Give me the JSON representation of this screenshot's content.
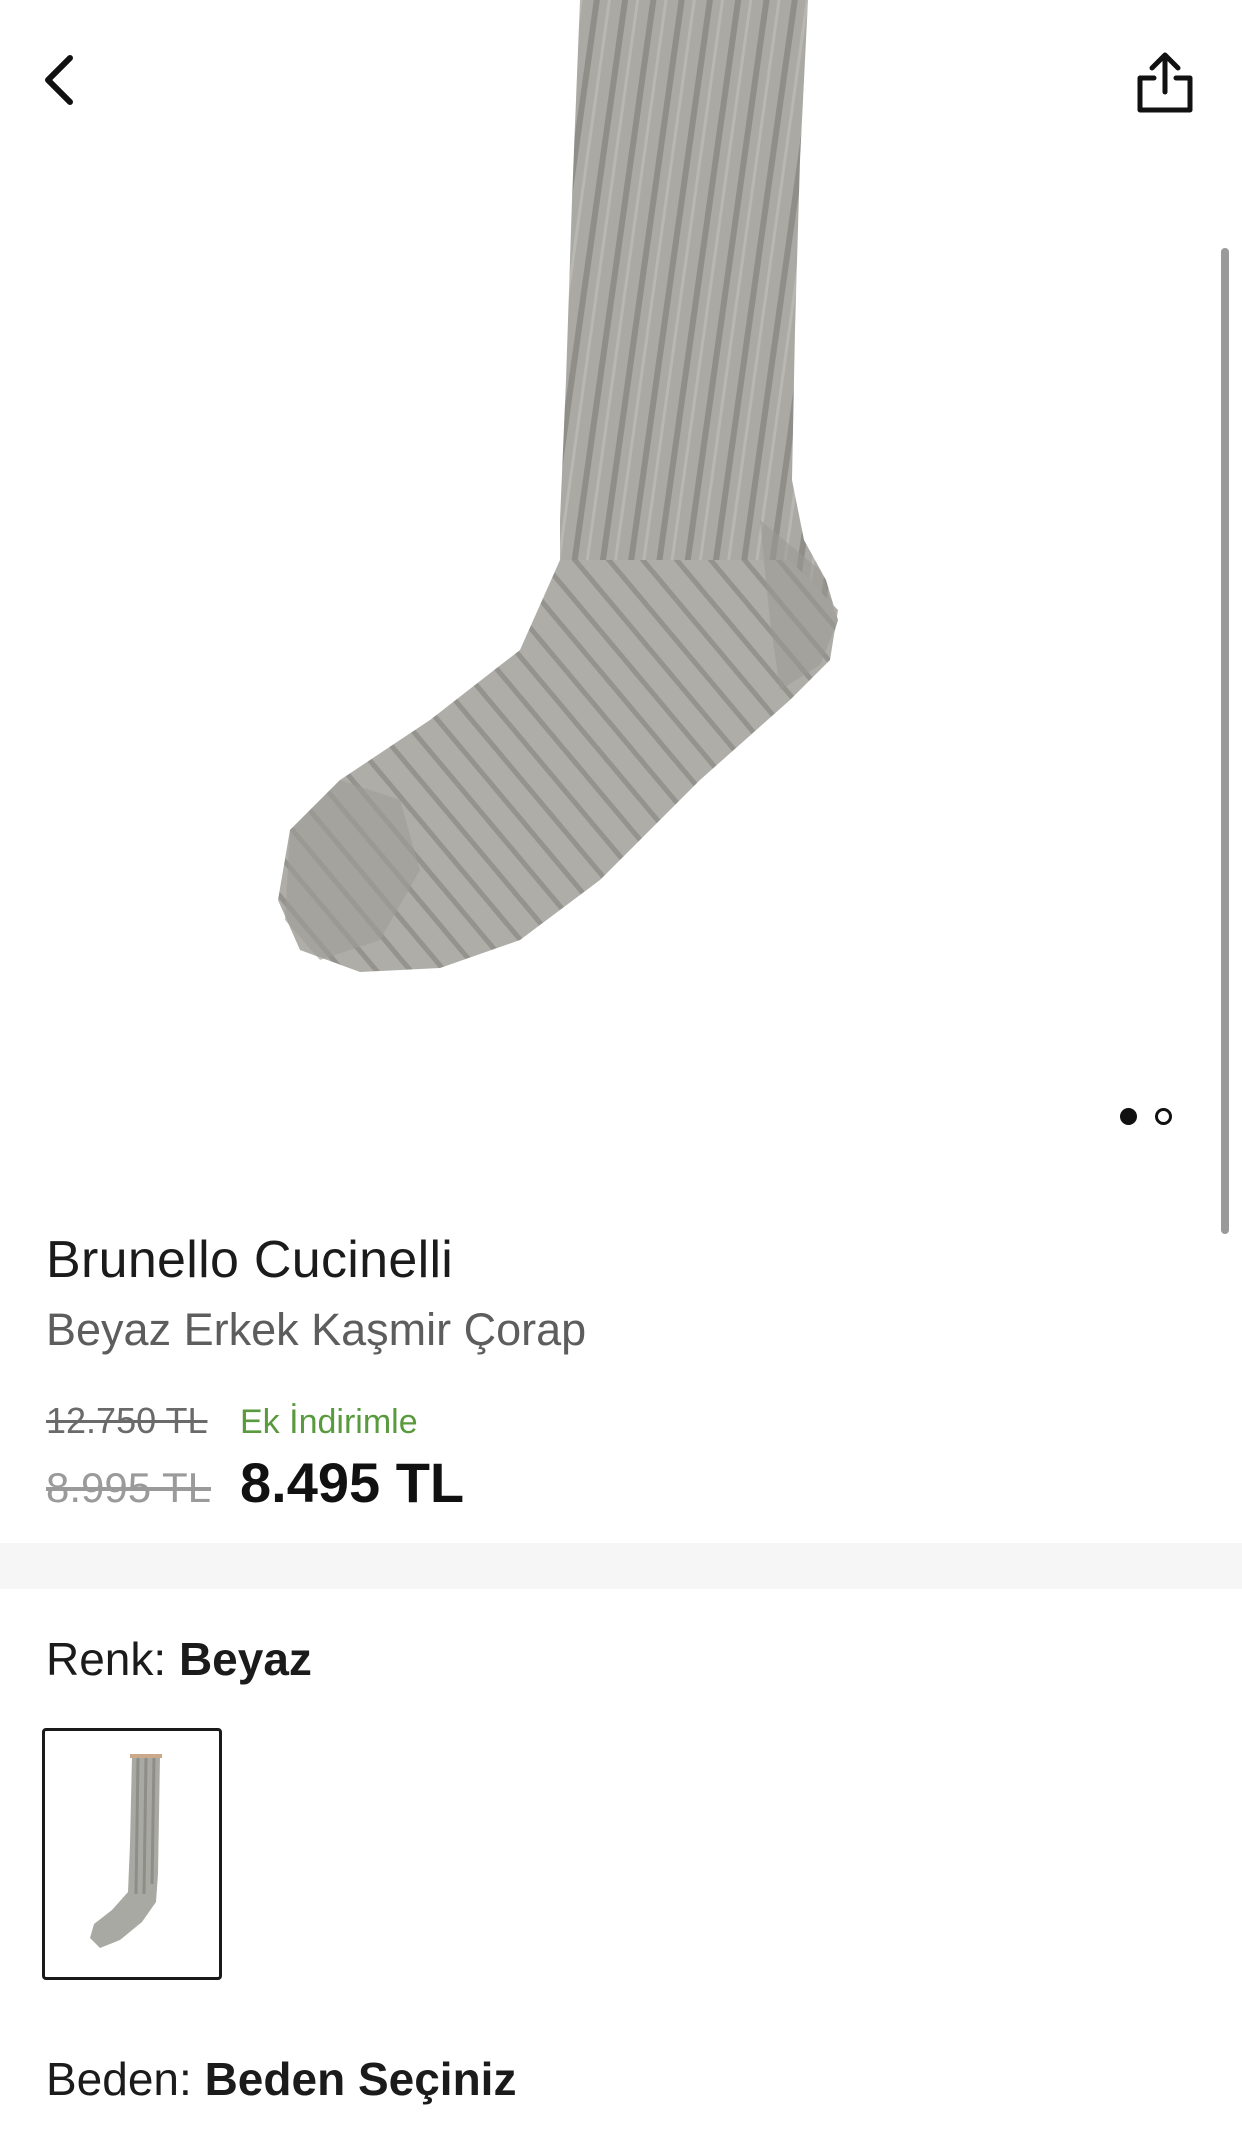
{
  "header": {
    "back_icon": "chevron-left-icon",
    "share_icon": "share-icon"
  },
  "gallery": {
    "image_description_icon": "grey-ribbed-sock",
    "page_count": 2,
    "active_page": 1
  },
  "product": {
    "brand": "Brunello Cucinelli",
    "name": "Beyaz Erkek Kaşmir Çorap"
  },
  "pricing": {
    "original_price": "12.750 TL",
    "discount_label": "Ek İndirimle",
    "sale_price": "8.995 TL",
    "final_price": "8.495 TL"
  },
  "color": {
    "label": "Renk:",
    "value": "Beyaz"
  },
  "size": {
    "label": "Beden:",
    "value": "Beden Seçiniz"
  },
  "colors": {
    "accent_green": "#5a9a3e",
    "text_dark": "#1b1b1b",
    "sock_grey": "#a9a9a4"
  }
}
